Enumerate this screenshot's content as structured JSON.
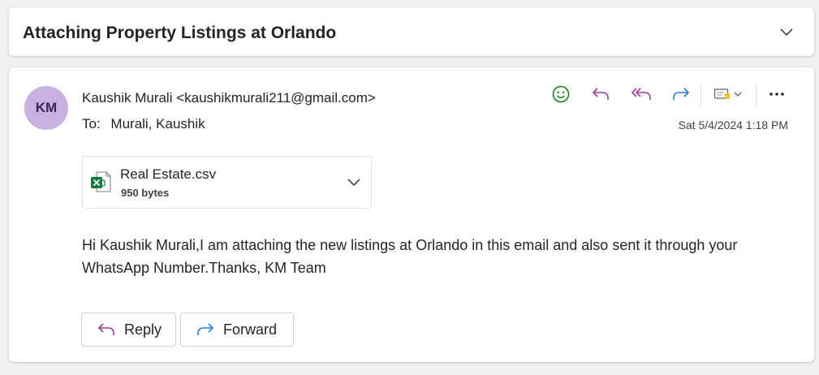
{
  "subject": {
    "title": "Attaching Property Listings at Orlando"
  },
  "message": {
    "avatar_initials": "KM",
    "sender": "Kaushik Murali <kaushikmurali211@gmail.com>",
    "to_label": "To:",
    "to_value": "Murali, Kaushik",
    "date": "Sat 5/4/2024 1:18 PM",
    "attachment": {
      "name": "Real Estate.csv",
      "size": "950 bytes",
      "icon": "excel-file-icon"
    },
    "body": "Hi Kaushik Murali,I am attaching the new listings at Orlando in this email and also sent it through your WhatsApp Number.Thanks, KM Team"
  },
  "toolbar": {
    "icons": [
      "emoji-icon",
      "reply-icon",
      "reply-all-icon",
      "forward-icon",
      "apps-icon",
      "chevron-down-icon",
      "more-icon"
    ]
  },
  "actions": {
    "reply_label": "Reply",
    "forward_label": "Forward"
  },
  "colors": {
    "avatar_bg": "#c8b0e0",
    "reply_purple": "#9b3c9b",
    "forward_blue": "#2b7bd6",
    "emoji_green": "#107c10",
    "excel_green": "#107c41"
  }
}
